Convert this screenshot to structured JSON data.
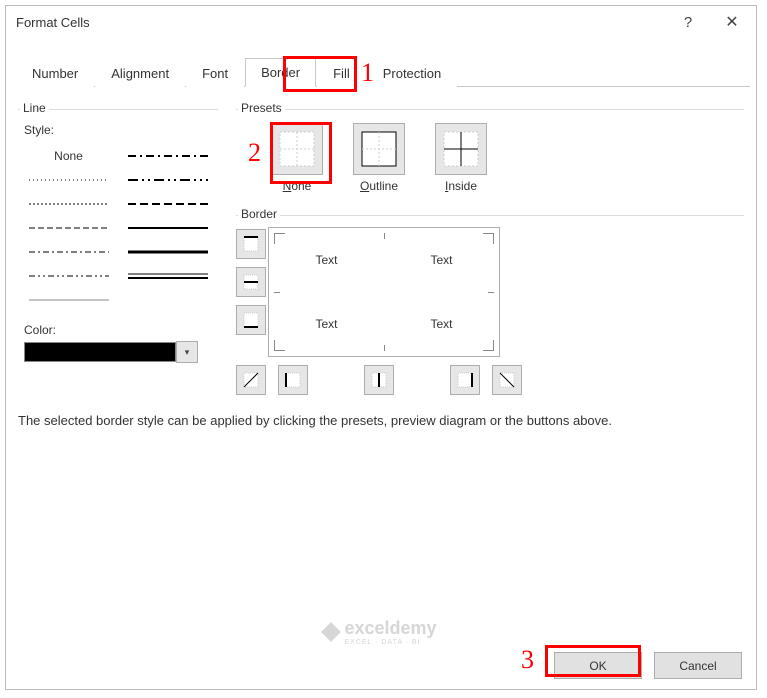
{
  "dialog": {
    "title": "Format Cells",
    "tabs": [
      "Number",
      "Alignment",
      "Font",
      "Border",
      "Fill",
      "Protection"
    ],
    "active_tab": "Border",
    "line": {
      "group_label": "Line",
      "style_label": "Style:",
      "none_label": "None",
      "color_label": "Color:",
      "color_value": "#000000"
    },
    "presets": {
      "group_label": "Presets",
      "items": [
        {
          "label": "None"
        },
        {
          "label": "Outline"
        },
        {
          "label": "Inside"
        }
      ]
    },
    "border": {
      "group_label": "Border",
      "preview_text": "Text"
    },
    "help_text": "The selected border style can be applied by clicking the presets, preview diagram or the buttons above.",
    "buttons": {
      "ok": "OK",
      "cancel": "Cancel"
    }
  },
  "annotations": {
    "n1": "1",
    "n2": "2",
    "n3": "3"
  },
  "watermark": {
    "brand": "exceldemy",
    "sub": "EXCEL · DATA · BI"
  }
}
